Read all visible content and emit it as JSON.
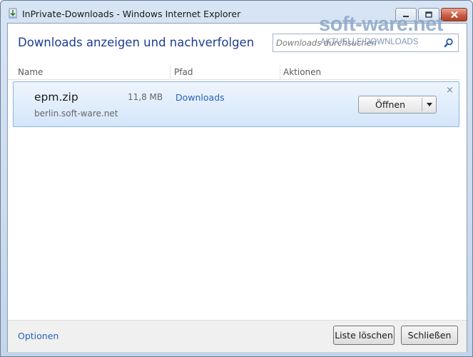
{
  "window": {
    "title": "InPrivate-Downloads - Windows Internet Explorer",
    "controls": {
      "minimize": "minimize",
      "maximize": "maximize",
      "close": "close"
    }
  },
  "watermark": "soft-ware.net",
  "header": {
    "title": "Downloads anzeigen und nachverfolgen",
    "search": {
      "placeholder": "Downloads durchsuchen",
      "caps_overlay": "AKTUELLE DOWNLOADS",
      "icon": "search-icon"
    }
  },
  "columns": {
    "name": "Name",
    "path": "Pfad",
    "actions": "Aktionen"
  },
  "downloads": [
    {
      "name": "epm.zip",
      "size": "11,8 MB",
      "source": "berlin.soft-ware.net",
      "path": "Downloads",
      "action": "Öffnen",
      "action_dropdown": "▾",
      "remove": "×"
    }
  ],
  "footer": {
    "options": "Optionen",
    "clear_list": "Liste löschen",
    "close": "Schließen"
  },
  "colors": {
    "heading": "#1e3b8f",
    "link": "#2763b8",
    "row_bg": "#d4e6fa",
    "row_border": "#8cb3e0",
    "close_button": "#c75a43"
  }
}
